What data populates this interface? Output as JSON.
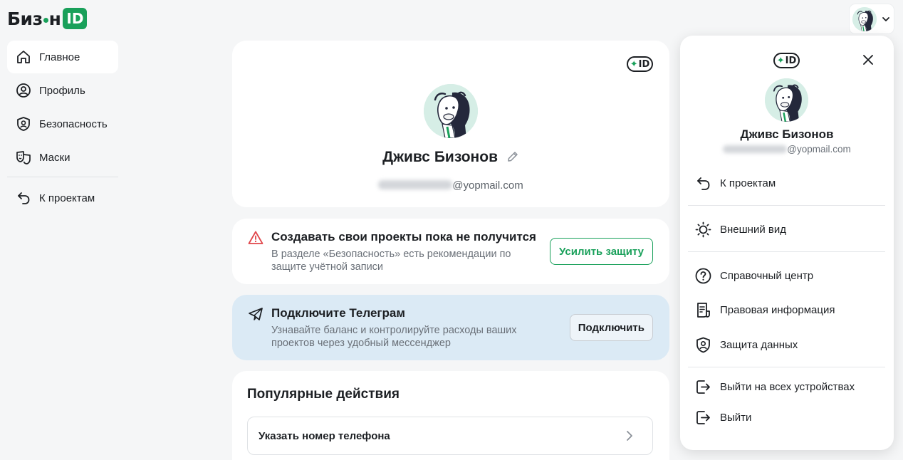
{
  "header": {
    "logo_text_left": "Биз",
    "logo_text_right": "н",
    "logo_badge": "ID",
    "brand_color": "#19a05a"
  },
  "sidebar": {
    "items": [
      {
        "label": "Главное",
        "icon": "home-icon",
        "active": true
      },
      {
        "label": "Профиль",
        "icon": "user-circle-icon",
        "active": false
      },
      {
        "label": "Безопасность",
        "icon": "shield-user-icon",
        "active": false
      },
      {
        "label": "Маски",
        "icon": "theater-masks-icon",
        "active": false
      }
    ],
    "back_item": {
      "label": "К проектам",
      "icon": "back-arrow-icon"
    }
  },
  "profile": {
    "id_badge": "ID",
    "name": "Дживс Бизонов",
    "email_domain": "@yopmail.com"
  },
  "warning": {
    "title": "Создавать свои проекты пока не получится",
    "text": "В разделе «Безопасность» есть рекомендации по защите учётной записи",
    "button": "Усилить защиту"
  },
  "telegram": {
    "title": "Подключите Телеграм",
    "text": "Узнавайте баланс и контролируйте расходы ваших проектов через удобный мессенджер",
    "button": "Подключить",
    "background": "#dbeaf5"
  },
  "popular": {
    "title": "Популярные действия",
    "items": [
      {
        "label": "Указать номер телефона"
      }
    ]
  },
  "panel": {
    "id_badge": "ID",
    "name": "Дживс Бизонов",
    "email_domain": "@yopmail.com",
    "menu": {
      "back": "К проектам",
      "appearance": "Внешний вид",
      "help": "Справочный центр",
      "legal": "Правовая информация",
      "privacy": "Защита данных",
      "logout_all": "Выйти на всех устройствах",
      "logout": "Выйти"
    }
  }
}
